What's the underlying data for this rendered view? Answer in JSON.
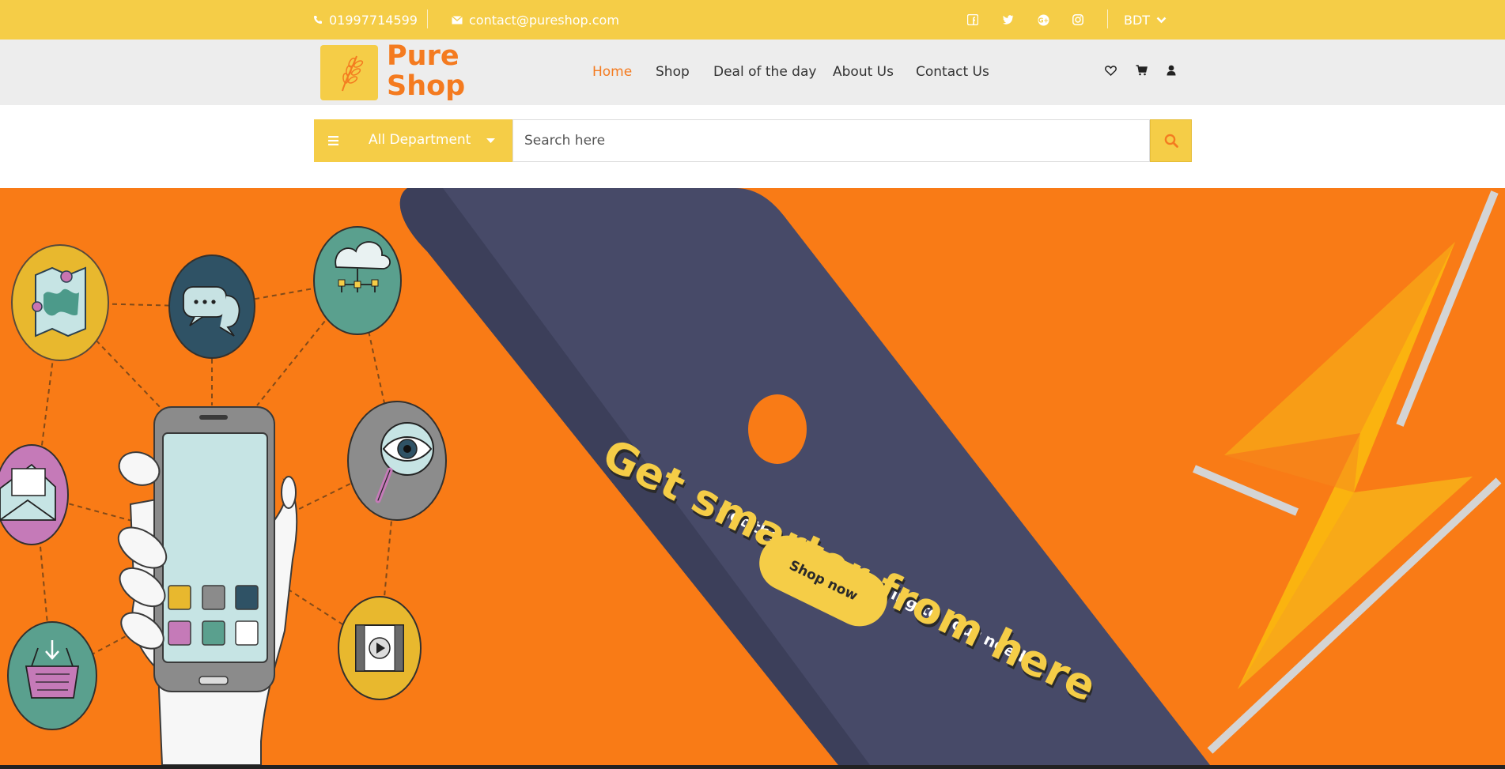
{
  "topbar": {
    "phone": "01997714599",
    "email": "contact@pureshop.com",
    "currency": "BDT",
    "social_icons": [
      "facebook-icon",
      "twitter-icon",
      "google-plus-icon",
      "instagram-icon"
    ]
  },
  "logo": {
    "line1": "Pure",
    "line2": "Shop"
  },
  "nav": {
    "items": [
      {
        "label": "Home"
      },
      {
        "label": "Shop"
      },
      {
        "label": "Deal of the day"
      },
      {
        "label": "About Us"
      },
      {
        "label": "Contact Us"
      }
    ],
    "icons": [
      "heart-icon",
      "cart-icon",
      "user-icon"
    ]
  },
  "search": {
    "department_label": "All Department",
    "placeholder": "Search here"
  },
  "hero": {
    "subtitle": "Get the phone according to your need",
    "headline": "Get smarter from here",
    "cta_label": "Shop now"
  },
  "colors": {
    "accent_yellow": "#f5cd47",
    "accent_orange": "#f47b20",
    "hero_orange": "#f97b16",
    "phone_slate": "#474a68"
  }
}
